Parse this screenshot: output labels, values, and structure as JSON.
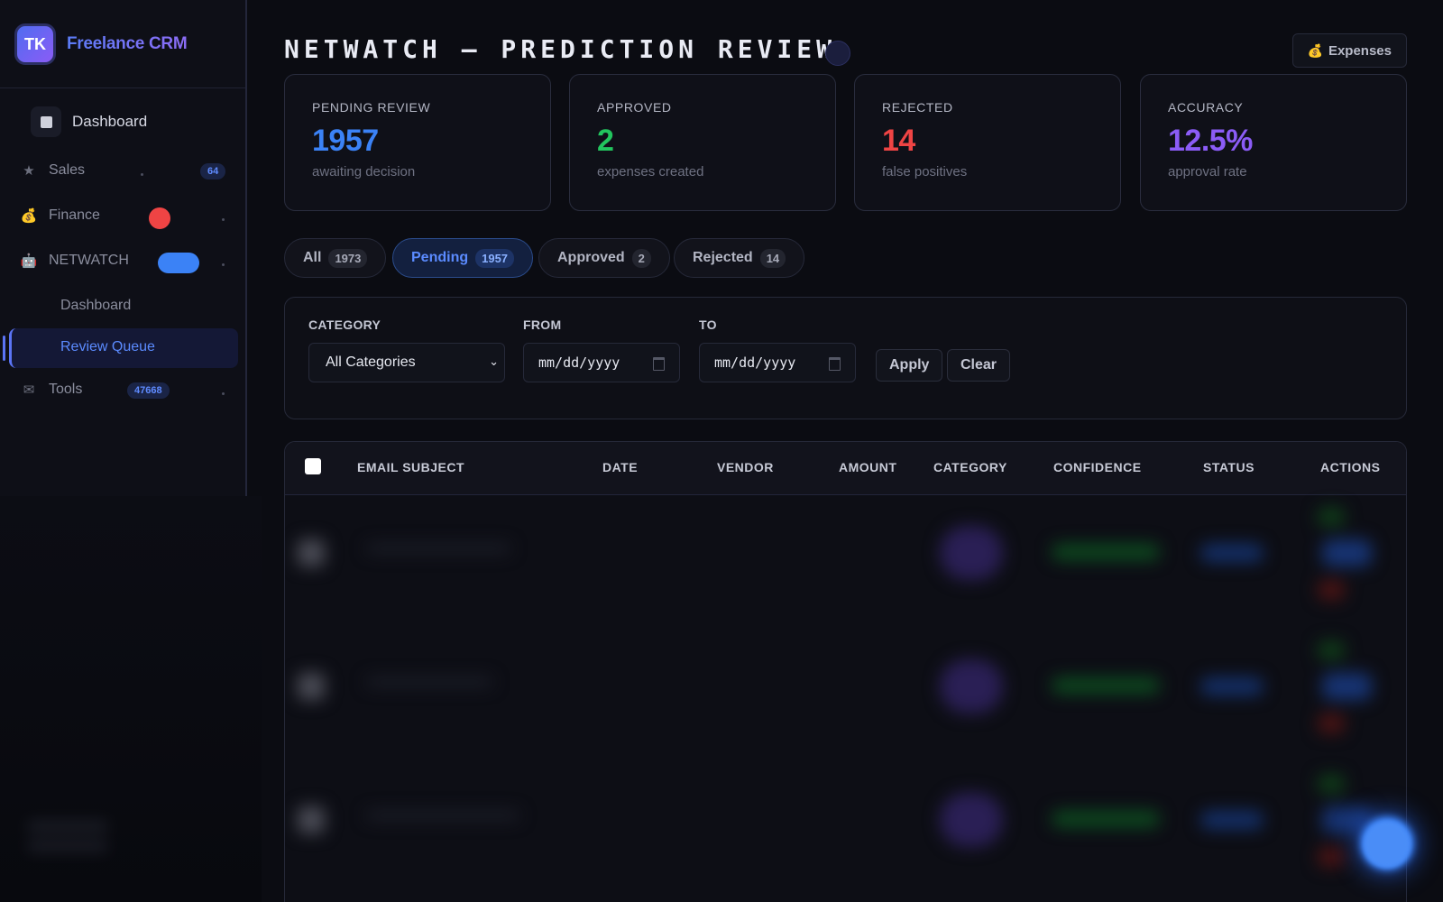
{
  "brand": {
    "initials": "TK",
    "name": "Freelance CRM"
  },
  "sidebar": {
    "dashboard": "Dashboard",
    "items": [
      {
        "label": "Sales",
        "icon": "star-icon",
        "badge": "64"
      },
      {
        "label": "Finance",
        "icon": "money-bag-icon"
      },
      {
        "label": "NETWATCH",
        "icon": "robot-icon"
      },
      {
        "label": "Tools",
        "icon": "mail-icon",
        "badge": "47668"
      }
    ],
    "netwatch_sub": [
      {
        "label": "Dashboard"
      },
      {
        "label": "Review Queue",
        "active": true
      }
    ]
  },
  "header": {
    "title": "NETWATCH — PREDICTION REVIEW",
    "expenses_button": "Expenses",
    "expenses_icon": "money-bag-icon"
  },
  "stats": [
    {
      "label": "PENDING REVIEW",
      "value": "1957",
      "sub": "awaiting decision",
      "color": "#3b82f6"
    },
    {
      "label": "APPROVED",
      "value": "2",
      "sub": "expenses created",
      "color": "#22c55e"
    },
    {
      "label": "REJECTED",
      "value": "14",
      "sub": "false positives",
      "color": "#ef4444"
    },
    {
      "label": "ACCURACY",
      "value": "12.5%",
      "sub": "approval rate",
      "color": "#8b5cf6"
    }
  ],
  "tabs": [
    {
      "label": "All",
      "count": "1973"
    },
    {
      "label": "Pending",
      "count": "1957",
      "active": true
    },
    {
      "label": "Approved",
      "count": "2"
    },
    {
      "label": "Rejected",
      "count": "14"
    }
  ],
  "filters": {
    "category_label": "CATEGORY",
    "category_value": "All Categories",
    "from_label": "FROM",
    "from_placeholder": "mm/dd/yyyy",
    "to_label": "TO",
    "to_placeholder": "mm/dd/yyyy",
    "apply": "Apply",
    "clear": "Clear"
  },
  "table": {
    "columns": [
      "EMAIL SUBJECT",
      "DATE",
      "VENDOR",
      "AMOUNT",
      "CATEGORY",
      "CONFIDENCE",
      "STATUS",
      "ACTIONS"
    ]
  },
  "colors": {
    "accent": "#5b8bff",
    "brand_gradient_start": "#5b7cf7",
    "brand_gradient_end": "#8b6cf5",
    "danger": "#ef4444"
  }
}
